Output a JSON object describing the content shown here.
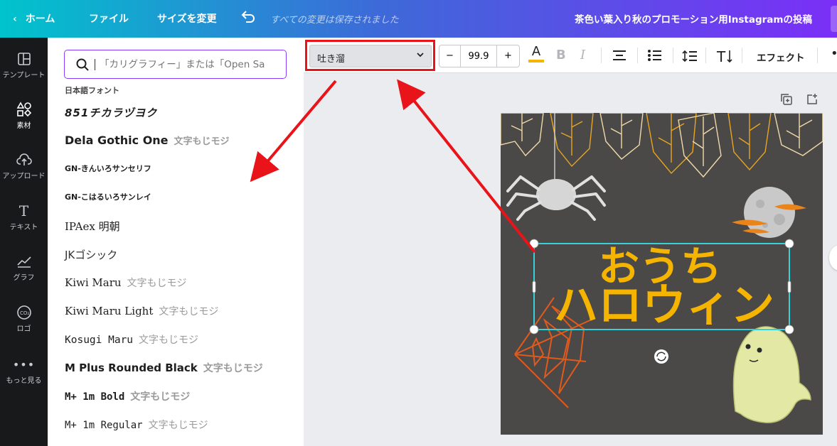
{
  "topbar": {
    "home": "ホーム",
    "file": "ファイル",
    "resize": "サイズを変更",
    "saved_status": "すべての変更は保存されました",
    "doc_title": "茶色い葉入り秋のプロモーション用Instagramの投稿"
  },
  "rail": [
    {
      "label": "テンプレート",
      "icon": "template-icon"
    },
    {
      "label": "素材",
      "icon": "elements-icon"
    },
    {
      "label": "アップロード",
      "icon": "upload-icon"
    },
    {
      "label": "テキスト",
      "icon": "text-icon"
    },
    {
      "label": "グラフ",
      "icon": "chart-icon"
    },
    {
      "label": "ロゴ",
      "icon": "logo-icon"
    },
    {
      "label": "もっと見る",
      "icon": "more-icon"
    }
  ],
  "panel": {
    "search_placeholder": "「カリグラフィー」または「Open Sans」",
    "section_title": "日本語フォント",
    "fonts": [
      {
        "name": "851チカラヅヨク",
        "sample": ""
      },
      {
        "name": "Dela Gothic One",
        "sample": "文字もじモジ"
      },
      {
        "name": "GN-きんいろサンセリフ",
        "sample": ""
      },
      {
        "name": "GN-こはるいろサンレイ",
        "sample": ""
      },
      {
        "name": "IPAex 明朝",
        "sample": ""
      },
      {
        "name": "JKゴシック",
        "sample": ""
      },
      {
        "name": "Kiwi Maru",
        "sample": "文字もじモジ"
      },
      {
        "name": "Kiwi Maru Light",
        "sample": "文字もじモジ"
      },
      {
        "name": "Kosugi Maru",
        "sample": "文字もじモジ"
      },
      {
        "name": "M Plus Rounded Black",
        "sample": "文字もじモジ"
      },
      {
        "name": "M+ 1m Bold",
        "sample": "文字もじモジ"
      },
      {
        "name": "M+ 1m Regular",
        "sample": "文字もじモジ"
      }
    ]
  },
  "toolbar": {
    "font_name": "吐き溜",
    "font_size": "99.9",
    "minus": "−",
    "plus": "+",
    "effects": "エフェクト"
  },
  "design": {
    "line1": "おうち",
    "line2": "ハロウィン"
  },
  "colors": {
    "accent": "#8b3dff",
    "highlight": "#e8141a",
    "selection": "#35d0d8",
    "title_text": "#f5b400"
  }
}
